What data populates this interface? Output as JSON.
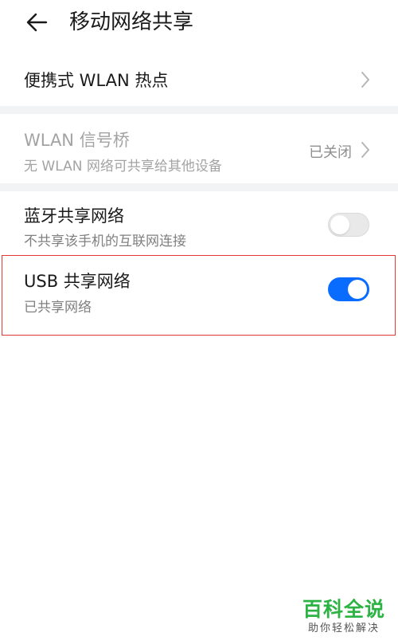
{
  "header": {
    "title": "移动网络共享"
  },
  "rows": {
    "hotspot": {
      "title": "便携式 WLAN 热点"
    },
    "wlan_bridge": {
      "title": "WLAN 信号桥",
      "subtitle": "无 WLAN 网络可共享给其他设备",
      "status": "已关闭"
    },
    "bluetooth": {
      "title": "蓝牙共享网络",
      "subtitle": "不共享该手机的互联网连接",
      "enabled": false
    },
    "usb": {
      "title": "USB 共享网络",
      "subtitle": "已共享网络",
      "enabled": true
    }
  },
  "colors": {
    "accent": "#0a6cff",
    "highlight": "#e53935",
    "watermark": "#2db244"
  },
  "watermark": {
    "main": "百科全说",
    "sub": "助你轻松解决"
  },
  "icons": [
    "back-arrow-icon",
    "chevron-right-icon"
  ]
}
